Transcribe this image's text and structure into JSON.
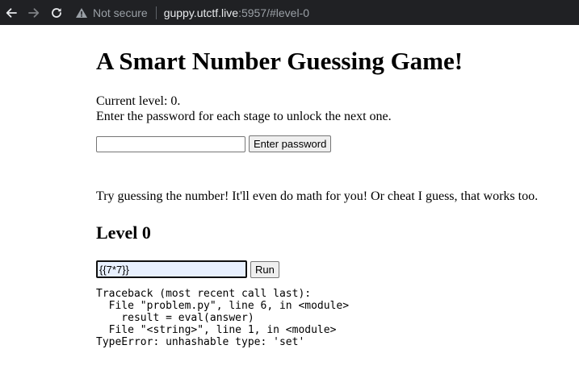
{
  "browser": {
    "security_label": "Not secure",
    "url_host": "guppy.utctf.live",
    "url_rest": ":5957/#level-0"
  },
  "page": {
    "title": "A Smart Number Guessing Game!",
    "current_level_text": "Current level: 0.",
    "instructions": "Enter the password for each stage to unlock the next one.",
    "password_value": "",
    "password_button": "Enter password",
    "hint": "Try guessing the number! It'll even do math for you! Or cheat I guess, that works too.",
    "level_heading": "Level 0",
    "answer_value": "{{7*7}}",
    "run_button": "Run",
    "traceback": "Traceback (most recent call last):\n  File \"problem.py\", line 6, in <module>\n    result = eval(answer)\n  File \"<string>\", line 1, in <module>\nTypeError: unhashable type: 'set'"
  }
}
